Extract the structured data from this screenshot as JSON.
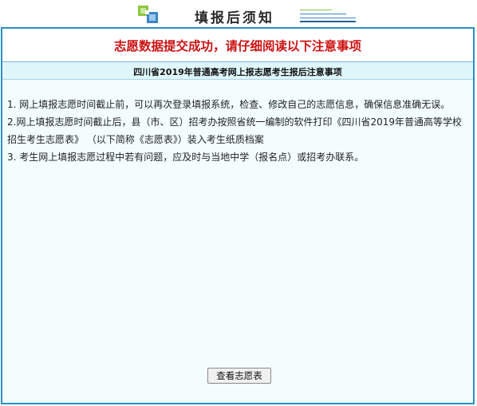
{
  "header": {
    "title": "填报后须知",
    "logo_icon": "square-tiles-logo-icon"
  },
  "notice": {
    "text": "志愿数据提交成功，请仔细阅读以下注意事项",
    "color": "#cc1111"
  },
  "subheader": {
    "text": "四川省2019年普通高考网上报志愿考生报后注意事项",
    "background": "#dff6fb"
  },
  "items": [
    "1. 网上填报志愿时间截止前，可以再次登录填报系统，检查、修改自己的志愿信息，确保信息准确无误。",
    "2.网上填报志愿时间截止后，县（市、区）招考办按照省统一编制的软件打印《四川省2019年普通高等学校招生考生志愿表》 （以下简称《志愿表》）装入考生纸质档案",
    "3. 考生网上填报志愿过程中若有问题，应及时与当地中学（报名点）或招考办联系。"
  ],
  "buttons": {
    "view_label": "查看志愿表"
  },
  "colors": {
    "frame_border": "#2a8fc7",
    "content_bg": "#f3fdfe"
  }
}
